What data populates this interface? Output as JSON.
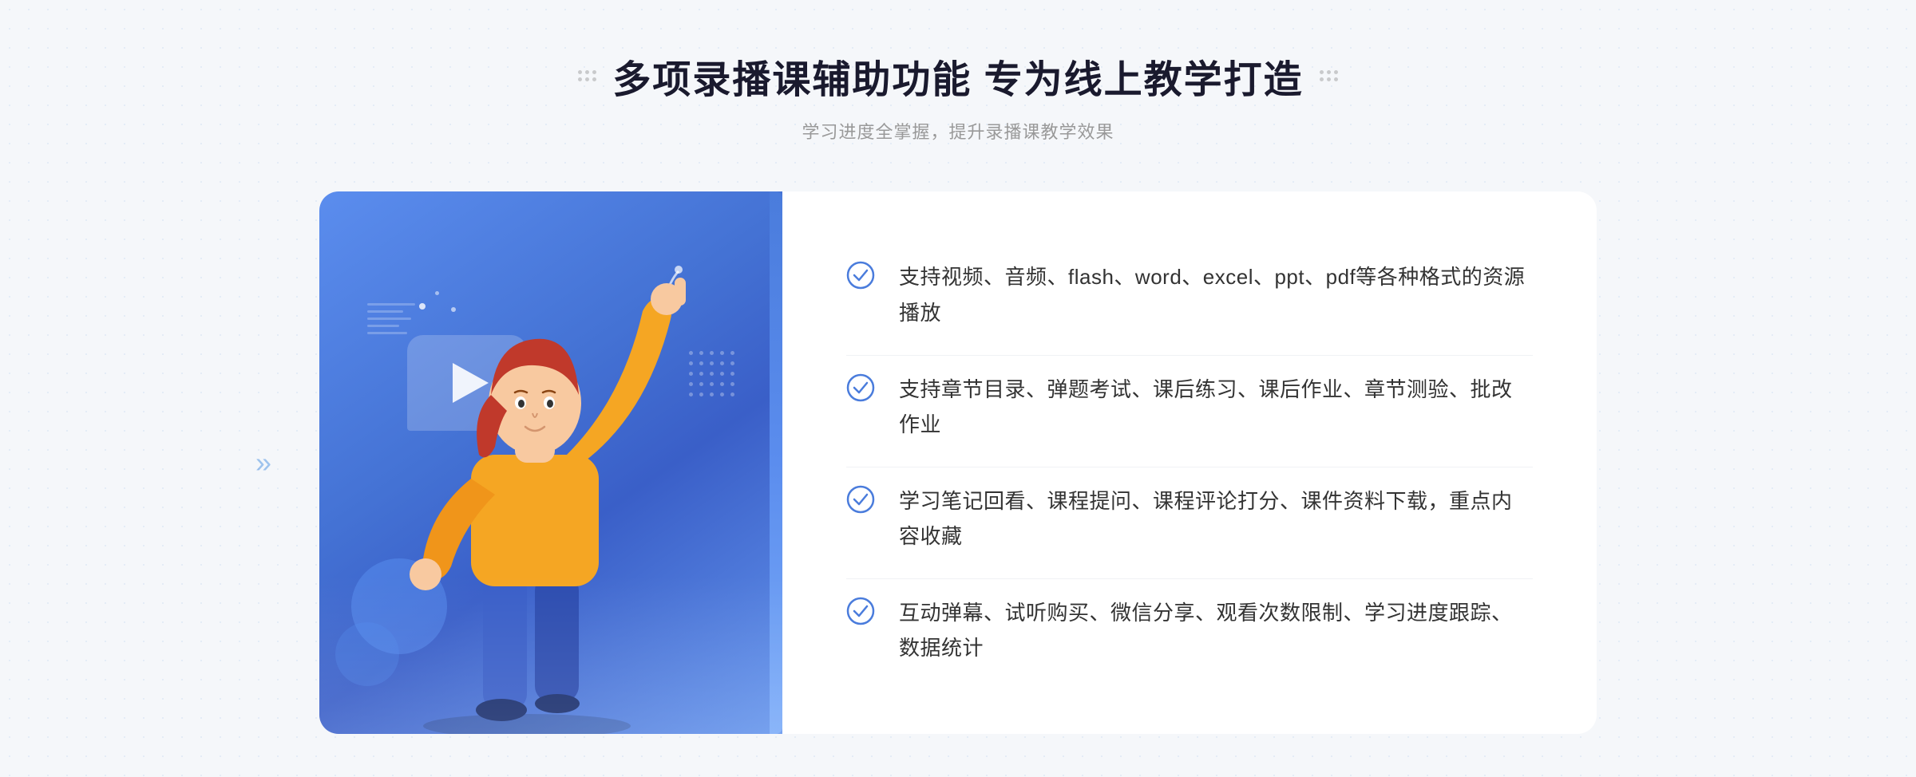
{
  "page": {
    "background_color": "#f5f7fa"
  },
  "header": {
    "title": "多项录播课辅助功能 专为线上教学打造",
    "subtitle": "学习进度全掌握，提升录播课教学效果",
    "decoration_left": "decorative dots",
    "decoration_right": "decorative dots"
  },
  "features": [
    {
      "id": 1,
      "text": "支持视频、音频、flash、word、excel、ppt、pdf等各种格式的资源播放"
    },
    {
      "id": 2,
      "text": "支持章节目录、弹题考试、课后练习、课后作业、章节测验、批改作业"
    },
    {
      "id": 3,
      "text": "学习笔记回看、课程提问、课程评论打分、课件资料下载，重点内容收藏"
    },
    {
      "id": 4,
      "text": "互动弹幕、试听购买、微信分享、观看次数限制、学习进度跟踪、数据统计"
    }
  ],
  "illustration": {
    "play_icon": "▶",
    "left_arrow": "«"
  },
  "colors": {
    "primary_blue": "#4a7cdc",
    "light_blue": "#5b8dee",
    "check_color": "#4a7cdc",
    "text_dark": "#333333",
    "text_subtitle": "#999999",
    "bg_light": "#f5f7fa"
  }
}
